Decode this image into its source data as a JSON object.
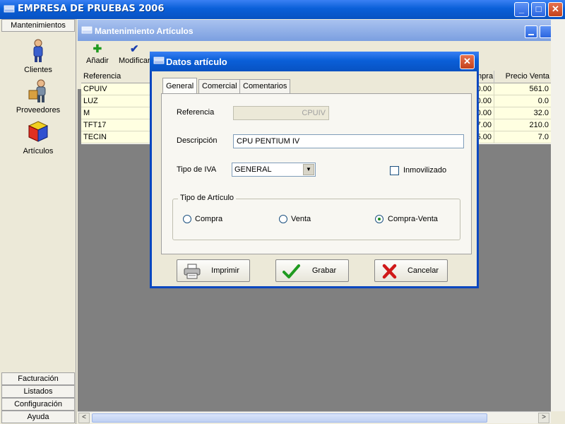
{
  "window": {
    "title": "EMPRESA DE PRUEBAS 2006"
  },
  "left_panel": {
    "header": "Mantenimientos",
    "items": [
      {
        "label": "Clientes",
        "icon": "client-person-icon"
      },
      {
        "label": "Proveedores",
        "icon": "supplier-person-icon"
      },
      {
        "label": "Artículos",
        "icon": "articles-boxes-icon"
      }
    ],
    "bottom_buttons": [
      "Facturación",
      "Listados",
      "Configuración",
      "Ayuda"
    ]
  },
  "child_window": {
    "title": "Mantenimiento Artículos",
    "toolbar": {
      "add_label": "Añadir",
      "modify_label": "Modificar"
    },
    "grid": {
      "columns": {
        "referencia": "Referencia",
        "compra": "mpra",
        "precio_venta": "Precio Venta"
      },
      "rows": [
        {
          "ref": "CPUIV",
          "compra": "0.00",
          "venta": "561.0"
        },
        {
          "ref": "LUZ",
          "compra": "0.00",
          "venta": "0.0"
        },
        {
          "ref": "M",
          "compra": "0.00",
          "venta": "32.0"
        },
        {
          "ref": "TFT17",
          "compra": "7.00",
          "venta": "210.0"
        },
        {
          "ref": "TECIN",
          "compra": "5.00",
          "venta": "7.0"
        }
      ]
    }
  },
  "dialog": {
    "title": "Datos artículo",
    "tabs": [
      "General",
      "Comercial",
      "Comentarios"
    ],
    "fields": {
      "referencia_label": "Referencia",
      "referencia_value": "CPUIV",
      "descripcion_label": "Descripción",
      "descripcion_value": "CPU PENTIUM IV",
      "iva_label": "Tipo de IVA",
      "iva_value": "GENERAL",
      "inmovilizado_label": "Inmovilizado",
      "inmovilizado_checked": false
    },
    "tipo_articulo": {
      "legend": "Tipo de Artículo",
      "options": [
        "Compra",
        "Venta",
        "Compra-Venta"
      ],
      "selected": "Compra-Venta"
    },
    "buttons": {
      "print": "Imprimir",
      "save": "Grabar",
      "cancel": "Cancelar"
    }
  },
  "colors": {
    "titlebar_blue": "#0a5fd8",
    "grid_row_bg": "#ffffe1",
    "mdi_bg": "#808080",
    "save_check_green": "#1f9a1f",
    "cancel_red": "#d01818"
  }
}
